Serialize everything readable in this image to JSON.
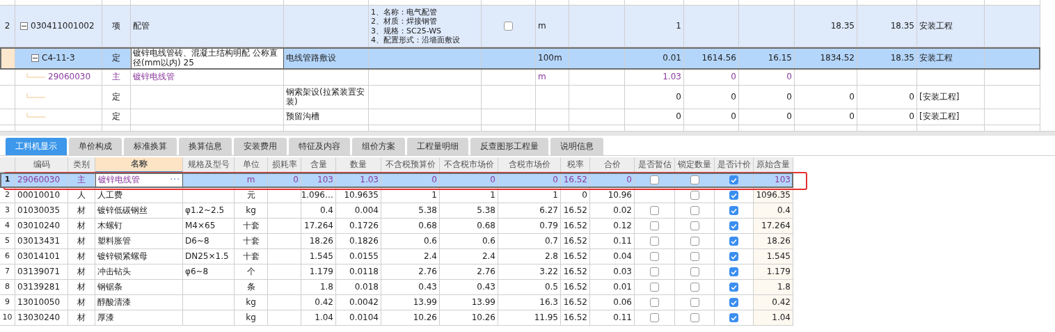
{
  "budget_table": {
    "rows": [
      {
        "kind": "item",
        "number": "2",
        "code": "030411001002",
        "expanded": true,
        "selected": false,
        "type": "项",
        "name": "配管",
        "features": [
          "1、名称：电气配管",
          "2、材质：焊接钢管",
          "3、规格：SC25-WS",
          "4、配置形式：沿墙面敷设"
        ],
        "checkbox": {
          "checked": false
        },
        "unit": "m",
        "quantity": "1",
        "column_13": "18.35",
        "column_14": "18.35",
        "specialty": "安装工程"
      },
      {
        "kind": "quota",
        "code": "C4-11-3",
        "expanded": true,
        "selected": true,
        "type": "定",
        "name": "镀锌电线管砖、混凝土结构明配 公称直径(mm以内) 25",
        "description": "电线管路敷设",
        "unit": "100m",
        "quantity": "0.01",
        "column_11": "1614.56",
        "column_12": "16.15",
        "column_13": "1834.52",
        "column_14": "18.35",
        "specialty": "安装工程"
      },
      {
        "kind": "main",
        "code": "29060030",
        "selected": false,
        "type": "主",
        "name": "镀锌电线管",
        "unit": "m",
        "quantity": "1.03",
        "column_11": "0",
        "column_12": "0"
      },
      {
        "kind": "sub",
        "selected": false,
        "type": "定",
        "description": "钢索架设(拉紧装置安装)",
        "quantity": "0",
        "column_11": "0",
        "column_12": "0",
        "column_13": "0",
        "column_14": "0",
        "specialty": "[安装工程]"
      },
      {
        "kind": "sub",
        "selected": false,
        "type": "定",
        "description": "预留沟槽",
        "quantity": "0",
        "column_11": "0",
        "column_12": "0",
        "column_13": "0",
        "column_14": "0",
        "specialty": "[安装工程]"
      }
    ]
  },
  "tabs": [
    {
      "label": "工料机显示",
      "selected": true
    },
    {
      "label": "单价构成",
      "selected": false
    },
    {
      "label": "标准换算",
      "selected": false
    },
    {
      "label": "换算信息",
      "selected": false
    },
    {
      "label": "安装费用",
      "selected": false
    },
    {
      "label": "特征及内容",
      "selected": false
    },
    {
      "label": "组价方案",
      "selected": false
    },
    {
      "label": "工程量明细",
      "selected": false
    },
    {
      "label": "反查图形工程量",
      "selected": false
    },
    {
      "label": "说明信息",
      "selected": false
    }
  ],
  "resource_table": {
    "columns": [
      {
        "label": "编码",
        "selected": false
      },
      {
        "label": "类别",
        "selected": false
      },
      {
        "label": "名称",
        "selected": true
      },
      {
        "label": "规格及型号",
        "selected": false
      },
      {
        "label": "单位",
        "selected": false
      },
      {
        "label": "损耗率",
        "selected": false
      },
      {
        "label": "含量",
        "selected": false
      },
      {
        "label": "数量",
        "selected": false
      },
      {
        "label": "不含税预算价",
        "selected": false
      },
      {
        "label": "不含税市场价",
        "selected": false
      },
      {
        "label": "含税市场价",
        "selected": false
      },
      {
        "label": "税率",
        "selected": false
      },
      {
        "label": "合价",
        "selected": false
      },
      {
        "label": "是否暂估",
        "selected": false
      },
      {
        "label": "锁定数量",
        "selected": false
      },
      {
        "label": "是否计价",
        "selected": false
      },
      {
        "label": "原始含量",
        "selected": false
      }
    ],
    "rows": [
      {
        "kind": "main",
        "selected": true,
        "number": "1",
        "code": "29060030",
        "type": "主",
        "name": "镀锌电线管",
        "name_button": "···",
        "unit": "m",
        "loss_rate": "0",
        "content": "103",
        "quantity": "1.03",
        "budget_price": "0",
        "market_price": "0",
        "market_price_tax": "0",
        "tax_rate": "16.52",
        "total": "0",
        "estimated": false,
        "locked": false,
        "priced": true,
        "original_content": "103"
      },
      {
        "kind": "labor",
        "selected": false,
        "number": "2",
        "code": "00010010",
        "type": "人",
        "name": "人工费",
        "unit": "元",
        "content": "1.096…",
        "quantity": "10.9635",
        "budget_price": "1",
        "market_price": "1",
        "market_price_tax": "1",
        "tax_rate": "0",
        "total": "10.96",
        "locked": false,
        "priced": true,
        "original_content": "1096.35"
      },
      {
        "kind": "material",
        "selected": false,
        "number": "3",
        "code": "01030035",
        "type": "材",
        "name": "镀锌低碳钢丝",
        "spec": "φ1.2~2.5",
        "unit": "kg",
        "content": "0.4",
        "quantity": "0.004",
        "budget_price": "5.38",
        "market_price": "5.38",
        "market_price_tax": "6.27",
        "tax_rate": "16.52",
        "total": "0.02",
        "estimated": false,
        "locked": false,
        "priced": true,
        "original_content": "0.4"
      },
      {
        "kind": "material",
        "selected": false,
        "number": "4",
        "code": "03010240",
        "type": "材",
        "name": "木螺钉",
        "spec": "M4×65",
        "unit": "十套",
        "content": "17.264",
        "quantity": "0.1726",
        "budget_price": "0.68",
        "market_price": "0.68",
        "market_price_tax": "0.79",
        "tax_rate": "16.52",
        "total": "0.12",
        "estimated": false,
        "locked": false,
        "priced": true,
        "original_content": "17.264"
      },
      {
        "kind": "material",
        "selected": false,
        "number": "5",
        "code": "03013431",
        "type": "材",
        "name": "塑料胀管",
        "spec": "D6~8",
        "unit": "十套",
        "content": "18.26",
        "quantity": "0.1826",
        "budget_price": "0.6",
        "market_price": "0.6",
        "market_price_tax": "0.7",
        "tax_rate": "16.52",
        "total": "0.11",
        "estimated": false,
        "locked": false,
        "priced": true,
        "original_content": "18.26"
      },
      {
        "kind": "material",
        "selected": false,
        "number": "6",
        "code": "03014101",
        "type": "材",
        "name": "镀锌锁紧螺母",
        "spec": "DN25×1.5",
        "unit": "十套",
        "content": "1.545",
        "quantity": "0.0155",
        "budget_price": "2.4",
        "market_price": "2.4",
        "market_price_tax": "2.8",
        "tax_rate": "16.52",
        "total": "0.04",
        "estimated": false,
        "locked": false,
        "priced": true,
        "original_content": "1.545"
      },
      {
        "kind": "material",
        "selected": false,
        "number": "7",
        "code": "03139071",
        "type": "材",
        "name": "冲击钻头",
        "spec": "φ6~8",
        "unit": "个",
        "content": "1.179",
        "quantity": "0.0118",
        "budget_price": "2.76",
        "market_price": "2.76",
        "market_price_tax": "3.22",
        "tax_rate": "16.52",
        "total": "0.03",
        "estimated": false,
        "locked": false,
        "priced": true,
        "original_content": "1.179"
      },
      {
        "kind": "material",
        "selected": false,
        "number": "8",
        "code": "03139281",
        "type": "材",
        "name": "钢锯条",
        "unit": "条",
        "content": "1.8",
        "quantity": "0.018",
        "budget_price": "0.43",
        "market_price": "0.43",
        "market_price_tax": "0.5",
        "tax_rate": "16.52",
        "total": "0.01",
        "estimated": false,
        "locked": false,
        "priced": true,
        "original_content": "1.8"
      },
      {
        "kind": "material",
        "selected": false,
        "number": "9",
        "code": "13010050",
        "type": "材",
        "name": "醇酸清漆",
        "unit": "kg",
        "content": "0.42",
        "quantity": "0.0042",
        "budget_price": "13.99",
        "market_price": "13.99",
        "market_price_tax": "16.3",
        "tax_rate": "16.52",
        "total": "0.06",
        "estimated": false,
        "locked": false,
        "priced": true,
        "original_content": "0.42"
      },
      {
        "kind": "material",
        "selected": false,
        "number": "10",
        "code": "13030240",
        "type": "材",
        "name": "厚漆",
        "unit": "kg",
        "content": "1.04",
        "quantity": "0.0104",
        "budget_price": "10.26",
        "market_price": "10.26",
        "market_price_tax": "11.95",
        "tax_rate": "16.52",
        "total": "0.11",
        "estimated": false,
        "locked": false,
        "priced": true,
        "original_content": "1.04"
      }
    ]
  }
}
